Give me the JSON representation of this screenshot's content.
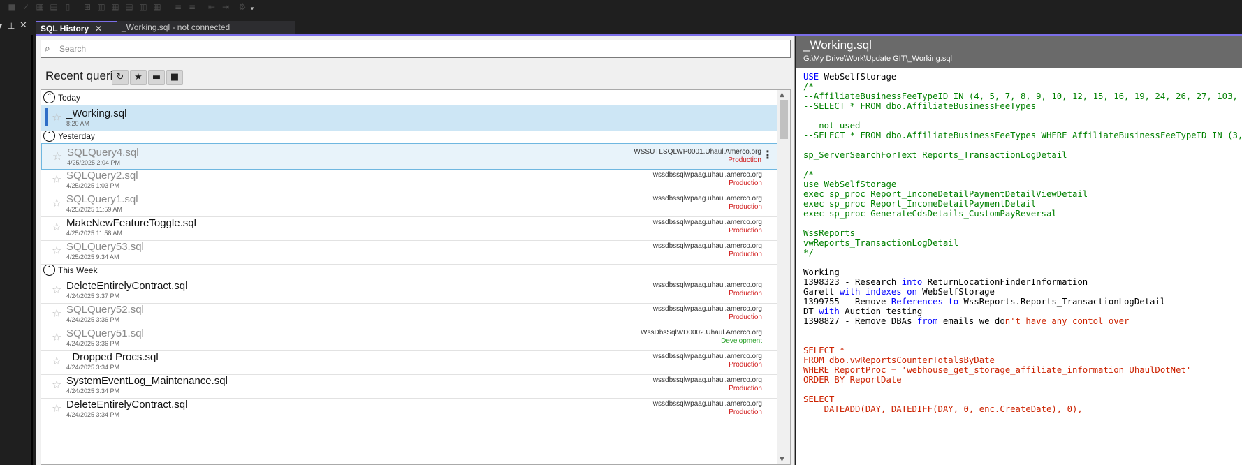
{
  "tabs": {
    "history_label": "SQL History",
    "working_label": "_Working.sql - not connected"
  },
  "search": {
    "placeholder": "Search"
  },
  "recent": {
    "title": "Recent queries"
  },
  "groups": {
    "today": "Today",
    "yesterday": "Yesterday",
    "this_week": "This Week"
  },
  "rows": [
    {
      "name": "_Working.sql",
      "date": "8:20 AM",
      "server": "",
      "env": "",
      "state": "selected",
      "dim": false
    },
    {
      "name": "SQLQuery4.sql",
      "date": "4/25/2025 2:04 PM",
      "server": "WSSUTLSQLWP0001.Uhaul.Amerco.org",
      "env": "Production",
      "state": "hover",
      "dim": true
    },
    {
      "name": "SQLQuery2.sql",
      "date": "4/25/2025 1:03 PM",
      "server": "wssdbssqlwpaag.uhaul.amerco.org",
      "env": "Production",
      "state": "",
      "dim": true
    },
    {
      "name": "SQLQuery1.sql",
      "date": "4/25/2025 11:59 AM",
      "server": "wssdbssqlwpaag.uhaul.amerco.org",
      "env": "Production",
      "state": "",
      "dim": true
    },
    {
      "name": "MakeNewFeatureToggle.sql",
      "date": "4/25/2025 11:58 AM",
      "server": "wssdbssqlwpaag.uhaul.amerco.org",
      "env": "Production",
      "state": "",
      "dim": false
    },
    {
      "name": "SQLQuery53.sql",
      "date": "4/25/2025 9:34 AM",
      "server": "wssdbssqlwpaag.uhaul.amerco.org",
      "env": "Production",
      "state": "",
      "dim": true
    },
    {
      "name": "DeleteEntirelyContract.sql",
      "date": "4/24/2025 3:37 PM",
      "server": "wssdbssqlwpaag.uhaul.amerco.org",
      "env": "Production",
      "state": "",
      "dim": false
    },
    {
      "name": "SQLQuery52.sql",
      "date": "4/24/2025 3:36 PM",
      "server": "wssdbssqlwpaag.uhaul.amerco.org",
      "env": "Production",
      "state": "",
      "dim": true
    },
    {
      "name": "SQLQuery51.sql",
      "date": "4/24/2025 3:36 PM",
      "server": "WssDbsSqlWD0002.Uhaul.Amerco.org",
      "env": "Development",
      "state": "",
      "dim": true
    },
    {
      "name": "_Dropped Procs.sql",
      "date": "4/24/2025 3:34 PM",
      "server": "wssdbssqlwpaag.uhaul.amerco.org",
      "env": "Production",
      "state": "",
      "dim": false
    },
    {
      "name": "SystemEventLog_Maintenance.sql",
      "date": "4/24/2025 3:34 PM",
      "server": "wssdbssqlwpaag.uhaul.amerco.org",
      "env": "Production",
      "state": "",
      "dim": false
    },
    {
      "name": "DeleteEntirelyContract.sql",
      "date": "4/24/2025 3:34 PM",
      "server": "wssdbssqlwpaag.uhaul.amerco.org",
      "env": "Production",
      "state": "",
      "dim": false
    }
  ],
  "colors": {
    "production": "#d01818",
    "development": "#2aa02a",
    "accent": "#7b6ee8",
    "selected": "#cde6f5"
  },
  "preview": {
    "title": "_Working.sql",
    "path": "G:\\My Drive\\Work\\Update GIT\\_Working.sql",
    "lines": [
      [
        [
          "USE",
          "blue"
        ],
        [
          " WebSelfStorage",
          "black"
        ]
      ],
      [
        [
          "/*",
          "green"
        ]
      ],
      [
        [
          "--AffiliateBusinessFeeTypeID IN (4, 5, 7, 8, 9, 10, 12, 15, 16, 19, 24, 26, 27, 103,",
          "green"
        ]
      ],
      [
        [
          "--SELECT * FROM dbo.AffiliateBusinessFeeTypes",
          "green"
        ]
      ],
      [
        [
          "",
          "black"
        ]
      ],
      [
        [
          "-- not used",
          "green"
        ]
      ],
      [
        [
          "--SELECT * FROM dbo.AffiliateBusinessFeeTypes WHERE AffiliateBusinessFeeTypeID IN (3,",
          "green"
        ]
      ],
      [
        [
          "",
          "black"
        ]
      ],
      [
        [
          "sp_ServerSearchForText Reports_TransactionLogDetail",
          "green"
        ]
      ],
      [
        [
          "",
          "black"
        ]
      ],
      [
        [
          "/*",
          "green"
        ]
      ],
      [
        [
          "use WebSelfStorage",
          "green"
        ]
      ],
      [
        [
          "exec sp_proc Report_IncomeDetailPaymentDetailViewDetail",
          "green"
        ]
      ],
      [
        [
          "exec sp_proc Report_IncomeDetailPaymentDetail",
          "green"
        ]
      ],
      [
        [
          "exec sp_proc GenerateCdsDetails_CustomPayReversal",
          "green"
        ]
      ],
      [
        [
          "",
          "black"
        ]
      ],
      [
        [
          "WssReports",
          "green"
        ]
      ],
      [
        [
          "vwReports_TransactionLogDetail",
          "green"
        ]
      ],
      [
        [
          "*/",
          "green"
        ]
      ],
      [
        [
          "",
          "black"
        ]
      ],
      [
        [
          "Working",
          "black"
        ]
      ],
      [
        [
          "1398323 - Research ",
          "black"
        ],
        [
          "into",
          "blue"
        ],
        [
          " ReturnLocationFinderInformation",
          "black"
        ]
      ],
      [
        [
          "Garett ",
          "black"
        ],
        [
          "with",
          "blue"
        ],
        [
          " ",
          "black"
        ],
        [
          "indexes",
          "blue"
        ],
        [
          " ",
          "black"
        ],
        [
          "on",
          "blue"
        ],
        [
          " WebSelfStorage",
          "black"
        ]
      ],
      [
        [
          "1399755 - Remove ",
          "black"
        ],
        [
          "References",
          "blue"
        ],
        [
          " ",
          "black"
        ],
        [
          "to",
          "blue"
        ],
        [
          " WssReports.Reports_TransactionLogDetail",
          "black"
        ]
      ],
      [
        [
          "DT ",
          "black"
        ],
        [
          "with",
          "blue"
        ],
        [
          " Auction testing",
          "black"
        ]
      ],
      [
        [
          "1398827 - Remove DBAs ",
          "black"
        ],
        [
          "from",
          "blue"
        ],
        [
          " emails we do",
          "black"
        ],
        [
          "n't have any contol over",
          "red"
        ]
      ],
      [
        [
          "",
          "black"
        ]
      ],
      [
        [
          "",
          "black"
        ]
      ],
      [
        [
          "SELECT *",
          "red"
        ]
      ],
      [
        [
          "FROM dbo.vwReportsCounterTotalsByDate",
          "red"
        ]
      ],
      [
        [
          "WHERE ReportProc = 'webhouse_get_storage_affiliate_information UhaulDotNet'",
          "red"
        ]
      ],
      [
        [
          "ORDER BY ReportDate",
          "red"
        ]
      ],
      [
        [
          "",
          "black"
        ]
      ],
      [
        [
          "SELECT",
          "red"
        ]
      ],
      [
        [
          "    DATEADD(DAY, DATEDIFF(DAY, 0, enc.CreateDate), 0),",
          "red"
        ]
      ]
    ]
  }
}
